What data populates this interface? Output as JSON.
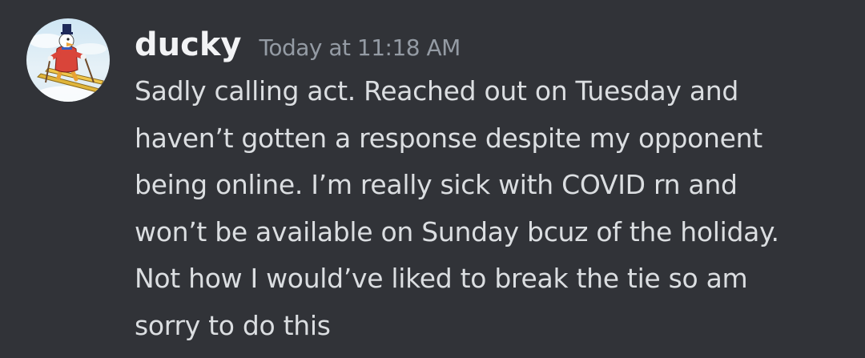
{
  "message": {
    "author": "ducky",
    "timestamp": "Today at 11:18 AM",
    "content_lines": [
      "Sadly calling act. Reached out on Tuesday and",
      "haven’t gotten a response despite my opponent",
      "being online. I’m really sick with COVID rn and",
      "won’t be available on Sunday bcuz of the holiday.",
      "Not how I would’ve liked to break the tie so am",
      "sorry to do this"
    ]
  },
  "colors": {
    "background": "#313338",
    "username": "#f2f3f5",
    "timestamp": "#949ba4",
    "message_text": "#dbdee1"
  },
  "icons": {
    "avatar": "scrooge-duck-skiing-avatar"
  }
}
